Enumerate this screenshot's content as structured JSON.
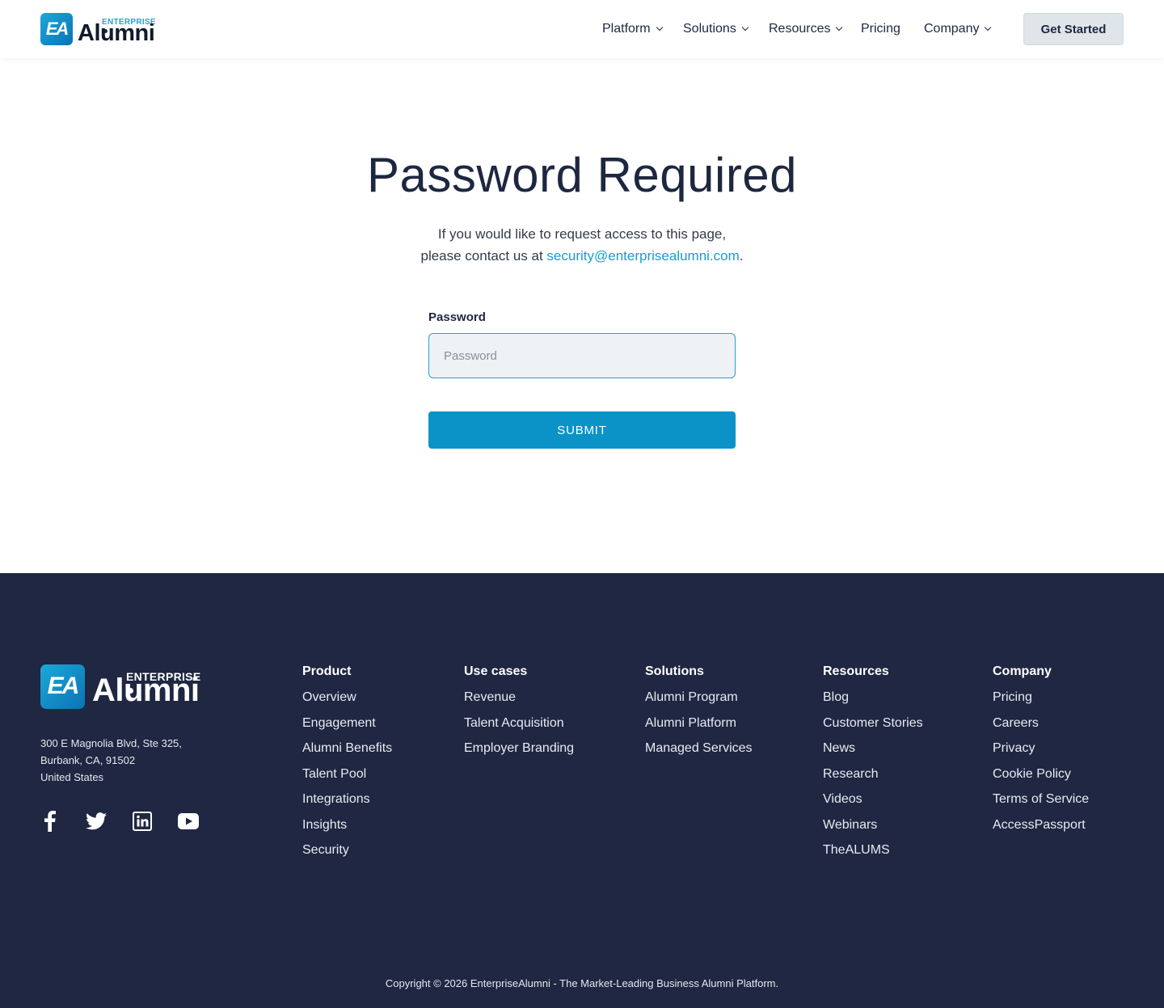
{
  "header": {
    "logo": {
      "badge": "EA",
      "enterprise": "ENTERPRISE",
      "alumni": "Alumni"
    },
    "nav": [
      {
        "label": "Platform",
        "dropdown": true
      },
      {
        "label": "Solutions",
        "dropdown": true
      },
      {
        "label": "Resources",
        "dropdown": true
      },
      {
        "label": "Pricing",
        "dropdown": false
      },
      {
        "label": "Company",
        "dropdown": true
      }
    ],
    "cta": "Get Started"
  },
  "main": {
    "title": "Password Required",
    "intro_line1": "If you would like to request access to this page,",
    "intro_line2_prefix": "please contact us at ",
    "email": "security@enterprisealumni.com",
    "intro_line2_suffix": ".",
    "password_label": "Password",
    "password_placeholder": "Password",
    "password_value": "",
    "submit_label": "SUBMIT"
  },
  "footer": {
    "logo": {
      "badge": "EA",
      "enterprise": "ENTERPRISE",
      "alumni": "Alumni"
    },
    "address": [
      "300 E Magnolia Blvd, Ste 325,",
      "Burbank, CA, 91502",
      "United States"
    ],
    "social": [
      "facebook-icon",
      "twitter-icon",
      "linkedin-icon",
      "youtube-icon"
    ],
    "columns": [
      {
        "heading": "Product",
        "items": [
          "Overview",
          "Engagement",
          "Alumni Benefits",
          "Talent Pool",
          "Integrations",
          "Insights",
          "Security"
        ]
      },
      {
        "heading": "Use cases",
        "items": [
          "Revenue",
          "Talent Acquisition",
          "Employer Branding"
        ]
      },
      {
        "heading": "Solutions",
        "items": [
          "Alumni Program",
          "Alumni Platform",
          "Managed Services"
        ]
      },
      {
        "heading": "Resources",
        "items": [
          "Blog",
          "Customer Stories",
          "News",
          "Research",
          "Videos",
          "Webinars",
          "TheALUMS"
        ]
      },
      {
        "heading": "Company",
        "items": [
          "Pricing",
          "Careers",
          "Privacy",
          "Cookie Policy",
          "Terms of Service",
          "AccessPassport"
        ]
      }
    ],
    "copyright": "Copyright © 2026 EnterpriseAlumni - The Market-Leading Business Alumni Platform."
  },
  "colors": {
    "accent": "#0b93c8",
    "link": "#1a9ccd",
    "footer_bg": "#1f2742",
    "text": "#1e2740"
  }
}
